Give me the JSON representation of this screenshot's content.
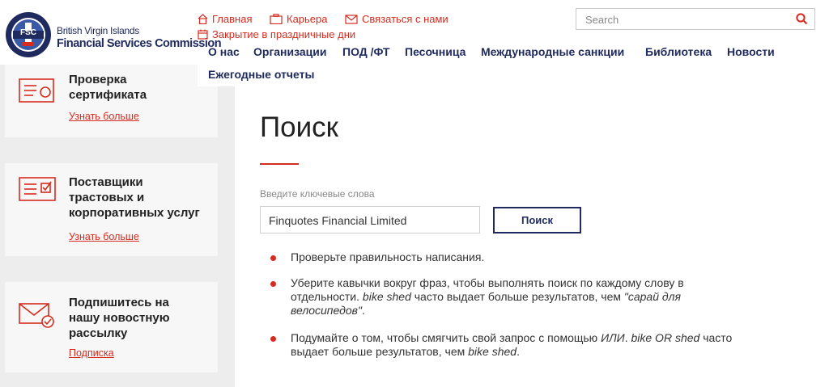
{
  "header": {
    "logo_text_line1": "British Virgin Islands",
    "logo_text_line2": "Financial Services Commission",
    "logo_badge": "FSC",
    "toplinks": [
      {
        "label": "Главная",
        "icon": "home-icon"
      },
      {
        "label": "Карьера",
        "icon": "briefcase-icon"
      },
      {
        "label": "Связаться с нами",
        "icon": "envelope-icon"
      },
      {
        "label": "Закрытие в праздничные дни",
        "icon": "calendar-icon"
      }
    ],
    "search_placeholder": "Search",
    "nav": [
      "О нас",
      "Организации",
      "ПОД /ФТ",
      "Песочница",
      "Международные санкции",
      "Библиотека",
      "Новости",
      "Ежегодные отчеты"
    ]
  },
  "sidebar": {
    "cards": [
      {
        "title_line1": "Проверка",
        "title_line2": "сертификата",
        "link": "Узнать больше",
        "icon": "certificate-icon"
      },
      {
        "title_line1": "Поставщики",
        "title_line2": "трастовых и",
        "title_line3": "корпоративных услуг",
        "link": "Узнать больше",
        "icon": "checklist-icon"
      },
      {
        "title_line1": "Подпишитесь на",
        "title_line2": "нашу новостную",
        "title_line3": "рассылку",
        "link": "Подписка",
        "icon": "mail-check-icon"
      }
    ]
  },
  "main": {
    "title": "Поиск",
    "keywords_label": "Введите ключевые слова",
    "keywords_value": "Finquotes Financial Limited",
    "search_button": "Поиск",
    "tips": {
      "t1": "Проверьте правильность написания.",
      "t2_a": "Уберите кавычки вокруг фраз, чтобы выполнять поиск по каждому слову в отдельности. ",
      "t2_b": "bike shed",
      "t2_c": " часто выдает больше результатов, чем ",
      "t2_d": "\"сарай для велосипедов\"",
      "t2_e": ".",
      "t3_a": "Подумайте о том, чтобы смягчить свой запрос с помощью ",
      "t3_b": "ИЛИ",
      "t3_c": ". ",
      "t3_d": "bike OR shed",
      "t3_e": " часто выдает больше результатов, чем ",
      "t3_f": "bike shed",
      "t3_g": "."
    }
  },
  "colors": {
    "accent": "#d62b1f",
    "navy": "#1f2a5e",
    "sidebar_bg": "#ededed"
  }
}
